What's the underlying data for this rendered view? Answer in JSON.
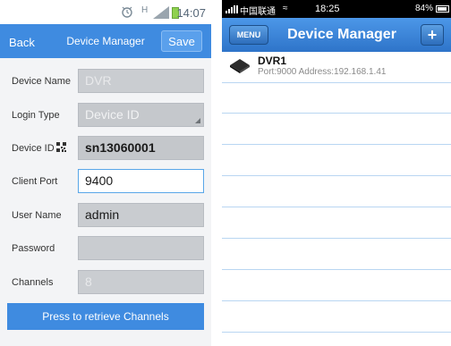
{
  "left": {
    "status": {
      "time": "14:07",
      "network": "H"
    },
    "appbar": {
      "back": "Back",
      "title": "Device Manager",
      "save": "Save"
    },
    "form": [
      {
        "label": "Device Name",
        "value": "DVR"
      },
      {
        "label": "Login Type",
        "value": "Device ID"
      },
      {
        "label": "Device ID",
        "value": "sn13060001"
      },
      {
        "label": "Client Port",
        "value": "9400"
      },
      {
        "label": "User Name",
        "value": "admin"
      },
      {
        "label": "Password",
        "value": ""
      },
      {
        "label": "Channels",
        "value": "8"
      }
    ],
    "retrieve_button": "Press to retrieve Channels"
  },
  "right": {
    "status": {
      "carrier": "中国联通",
      "time": "18:25",
      "battery": "84%"
    },
    "nav": {
      "menu": "MENU",
      "title": "Device Manager",
      "add": "+"
    },
    "devices": [
      {
        "name": "DVR1",
        "info": "Port:9000  Address:192.168.1.41"
      }
    ]
  },
  "colors": {
    "accent": "#3f8be0",
    "ios_nav": "#2e74c9",
    "separator": "#b9d6f2"
  },
  "icons": [
    "alarm-icon",
    "signal-icon",
    "battery-icon",
    "qr-code-icon",
    "wifi-icon",
    "dvr-device-icon",
    "plus-icon",
    "dropdown-triangle-icon"
  ]
}
